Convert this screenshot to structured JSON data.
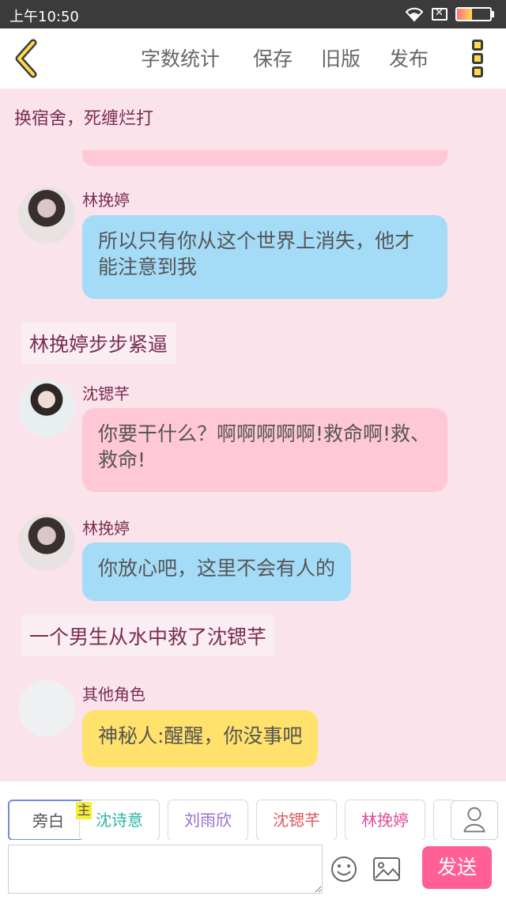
{
  "status_bar": {
    "time": "上午10:50",
    "icons": [
      "wifi-icon",
      "sim-off-icon",
      "battery-icon"
    ],
    "battery_level": 0.45
  },
  "header": {
    "back_icon": "chevron-left-icon",
    "menu": [
      "字数统计",
      "保存",
      "旧版",
      "发布"
    ],
    "more_icon": "more-vertical-icon"
  },
  "chat": {
    "title": "换宿舍，死缠烂打",
    "messages": [
      {
        "type": "speech",
        "speaker": "林挽婷",
        "text": "所以只有你从这个世界上消失，他才能注意到我",
        "bubble_color": "#a4dcf8"
      },
      {
        "type": "narration",
        "text": "林挽婷步步紧逼"
      },
      {
        "type": "speech",
        "speaker": "沈锶芊",
        "text": "你要干什么？啊啊啊啊啊!救命啊!救、救命!",
        "bubble_color": "#ffc8d6"
      },
      {
        "type": "speech",
        "speaker": "林挽婷",
        "text": "你放心吧，这里不会有人的",
        "bubble_color": "#a4dcf8"
      },
      {
        "type": "narration",
        "text": "一个男生从水中救了沈锶芊"
      },
      {
        "type": "speech",
        "speaker": "其他角色",
        "text": "神秘人:醒醒，你没事吧",
        "bubble_color": "#ffe16b"
      }
    ]
  },
  "roles": {
    "items": [
      "旁白",
      "沈诗意",
      "刘雨欣",
      "沈锶芊",
      "林挽婷"
    ],
    "selected": "旁白",
    "main_badge": "主",
    "person_icon": "person-icon"
  },
  "input": {
    "value": "",
    "emoji_icon": "emoji-icon",
    "image_icon": "image-icon",
    "send_label": "发送"
  }
}
